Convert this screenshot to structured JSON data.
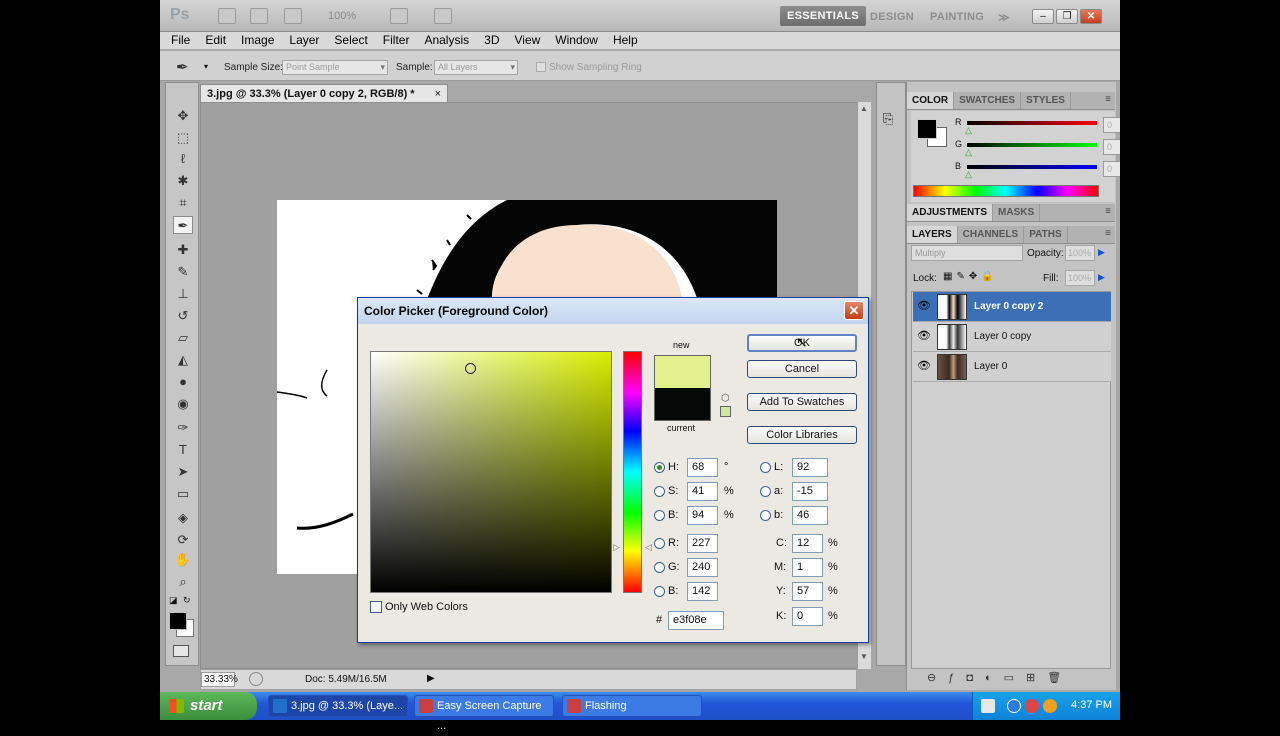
{
  "app": {
    "logo": "Ps",
    "zoom": "100%",
    "workspaces": [
      "ESSENTIALS",
      "DESIGN",
      "PAINTING"
    ],
    "overflow": "≫"
  },
  "menu": [
    "File",
    "Edit",
    "Image",
    "Layer",
    "Select",
    "Filter",
    "Analysis",
    "3D",
    "View",
    "Window",
    "Help"
  ],
  "options": {
    "sample_size_label": "Sample Size:",
    "sample_size_value": "Point Sample",
    "sample_label": "Sample:",
    "sample_value": "All Layers",
    "show_ring_label": "Show Sampling Ring"
  },
  "document": {
    "tab_title": "3.jpg @ 33.3% (Layer 0 copy 2, RGB/8) *",
    "close": "×",
    "zoom": "33.33%",
    "doc_info": "Doc: 5.49M/16.5M"
  },
  "color_panel": {
    "tabs": [
      "COLOR",
      "SWATCHES",
      "STYLES"
    ],
    "channels": [
      {
        "label": "R",
        "value": "0"
      },
      {
        "label": "G",
        "value": "0"
      },
      {
        "label": "B",
        "value": "0"
      }
    ]
  },
  "adjust_panel": {
    "tabs": [
      "ADJUSTMENTS",
      "MASKS"
    ]
  },
  "layers_panel": {
    "tabs": [
      "LAYERS",
      "CHANNELS",
      "PATHS"
    ],
    "blend_mode": "Multiply",
    "opacity_label": "Opacity:",
    "opacity_value": "100%",
    "lock_label": "Lock:",
    "fill_label": "Fill:",
    "fill_value": "100%",
    "layers": [
      {
        "name": "Layer 0 copy 2",
        "selected": true
      },
      {
        "name": "Layer 0 copy",
        "selected": false
      },
      {
        "name": "Layer 0",
        "selected": false
      }
    ]
  },
  "dialog": {
    "title": "Color Picker (Foreground Color)",
    "new_label": "new",
    "current_label": "current",
    "new_color": "#e3f08e",
    "current_color": "#050a08",
    "buttons": {
      "ok": "OK",
      "cancel": "Cancel",
      "swatches": "Add To Swatches",
      "libraries": "Color Libraries"
    },
    "only_web_colors": "Only Web Colors",
    "hsb": [
      {
        "label": "H:",
        "value": "68",
        "unit": "°",
        "on": true
      },
      {
        "label": "S:",
        "value": "41",
        "unit": "%",
        "on": false
      },
      {
        "label": "B:",
        "value": "94",
        "unit": "%",
        "on": false
      }
    ],
    "rgb": [
      {
        "label": "R:",
        "value": "227"
      },
      {
        "label": "G:",
        "value": "240"
      },
      {
        "label": "B:",
        "value": "142"
      }
    ],
    "lab": [
      {
        "label": "L:",
        "value": "92"
      },
      {
        "label": "a:",
        "value": "-15"
      },
      {
        "label": "b:",
        "value": "46"
      }
    ],
    "cmyk": [
      {
        "label": "C:",
        "value": "12",
        "unit": "%"
      },
      {
        "label": "M:",
        "value": "1",
        "unit": "%"
      },
      {
        "label": "Y:",
        "value": "57",
        "unit": "%"
      },
      {
        "label": "K:",
        "value": "0",
        "unit": "%"
      }
    ],
    "hex_label": "#",
    "hex_value": "e3f08e"
  },
  "taskbar": {
    "start": "start",
    "tasks": [
      "3.jpg @ 33.3% (Laye...",
      "Easy Screen Capture ...",
      "Flashing"
    ],
    "clock": "4:37 PM"
  }
}
